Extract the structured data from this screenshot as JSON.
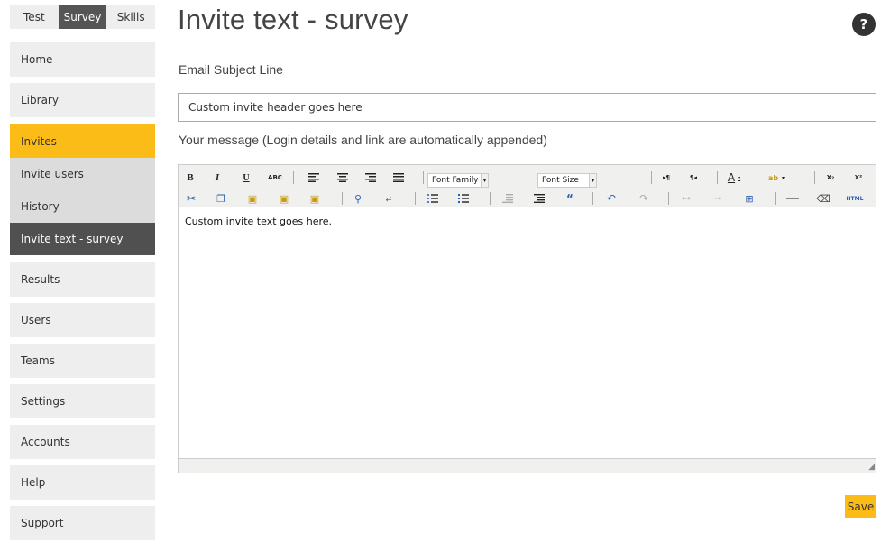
{
  "top_tabs": [
    {
      "label": "Test"
    },
    {
      "label": "Survey"
    },
    {
      "label": "Skills"
    }
  ],
  "sidebar": {
    "items": [
      {
        "label": "Home"
      },
      {
        "label": "Library"
      },
      {
        "label": "Invites"
      },
      {
        "label": "Results"
      },
      {
        "label": "Users"
      },
      {
        "label": "Teams"
      },
      {
        "label": "Settings"
      },
      {
        "label": "Accounts"
      },
      {
        "label": "Help"
      },
      {
        "label": "Support"
      }
    ],
    "sub_items": [
      {
        "label": "Invite users"
      },
      {
        "label": "History"
      },
      {
        "label": "Invite text - survey"
      }
    ]
  },
  "page": {
    "title": "Invite text - survey",
    "help_label": "?",
    "subject_label": "Email Subject Line",
    "subject_value": "Custom invite header goes here",
    "message_label": "Your message (Login details and link are automatically appended)",
    "save_label": "Save"
  },
  "editor": {
    "font_family_label": "Font Family",
    "font_size_label": "Font Size",
    "content": "Custom invite text goes here.",
    "toolbar_glyphs": {
      "bold": "B",
      "italic": "I",
      "underline": "U",
      "strike": "ABC",
      "subscript": "X₂",
      "superscript": "X²",
      "html": "HTML"
    }
  },
  "colors": {
    "accent": "#fbbc17",
    "dark": "#505050",
    "nav_bg": "#eeeeee",
    "sub_bg": "#dcdcdc"
  }
}
